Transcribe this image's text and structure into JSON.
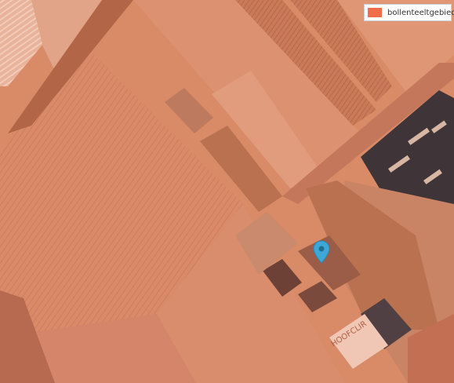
{
  "map": {
    "type": "satellite-with-overlay",
    "overlay_color": "#f26c48",
    "legend": {
      "swatch_color": "#f26c48",
      "label": "bollenteeltgebied"
    },
    "marker": {
      "icon": "map-pin-icon",
      "color": "#3fa7d6"
    },
    "building_sign": "HOOFCLIR"
  }
}
